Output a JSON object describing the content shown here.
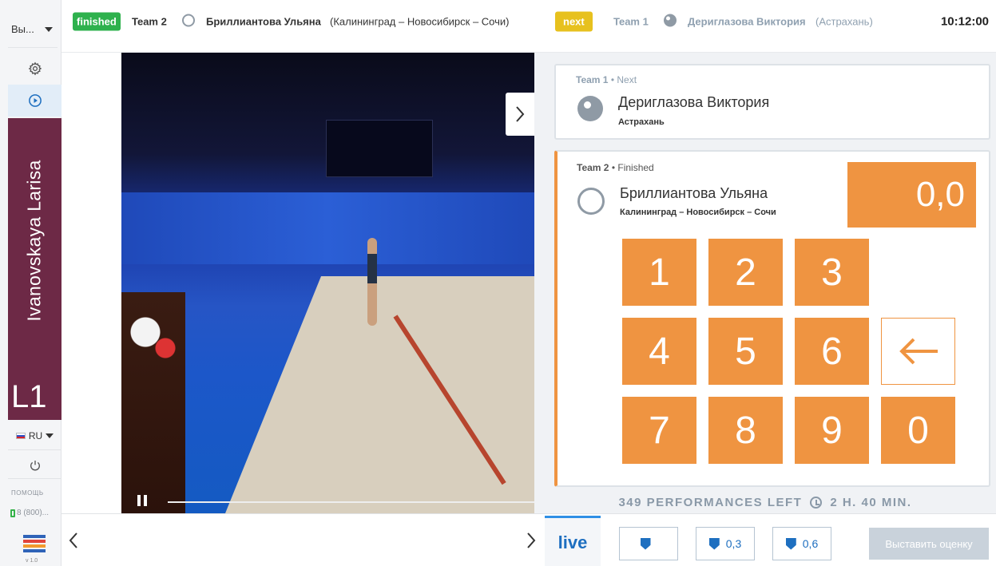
{
  "sidebar": {
    "selector_label": "Вы...",
    "judge_name": "Ivanovskaya Larisa",
    "judge_code": "L1",
    "language": "RU",
    "help_label": "ПОМОЩЬ",
    "help_phone": "8 (800)...",
    "version": "v 1.0",
    "band_color": "#6d2946"
  },
  "topbar": {
    "finished_badge": "finished",
    "finished_team": "Team 2",
    "finished_name": "Бриллиантова Ульяна",
    "finished_city": "(Калининград – Новосибирск – Сочи)",
    "next_badge": "next",
    "next_team": "Team 1",
    "next_name": "Дериглазова Виктория",
    "next_city": "(Астрахань)",
    "clock": "10:12:00"
  },
  "next_card": {
    "team": "Team 1",
    "status": "Next",
    "name": "Дериглазова Виктория",
    "city": "Астрахань",
    "apparatus_icon": "ball-icon"
  },
  "current_card": {
    "team": "Team 2",
    "status": "Finished",
    "name": "Бриллиантова Ульяна",
    "city": "Калининград – Новосибирск – Сочи",
    "apparatus_icon": "hoop-icon",
    "score": "0,0"
  },
  "keypad": {
    "keys": [
      "1",
      "2",
      "3",
      "4",
      "5",
      "6",
      "7",
      "8",
      "9",
      "0"
    ],
    "backspace_icon": "arrow-left-icon",
    "accent_color": "#ef9441"
  },
  "footer_info": {
    "performances_left": "349 PERFORMANCES LEFT",
    "time_left": "2 H. 40 MIN."
  },
  "bottombar": {
    "live_tab": "live",
    "penalty_buttons": [
      "",
      "0,3",
      "0,6"
    ],
    "submit_label": "Выставить оценку"
  }
}
